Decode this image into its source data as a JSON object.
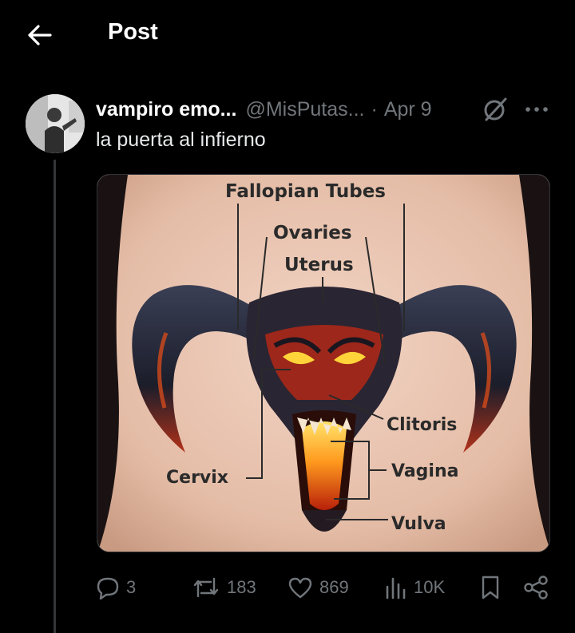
{
  "header": {
    "title": "Post",
    "back_icon": "arrow-left-icon"
  },
  "post": {
    "display_name": "vampiro emo...",
    "handle": "@MisPutas...",
    "separator": "·",
    "date": "Apr 9",
    "text": "la puerta al infierno",
    "icons": {
      "grok": "grok-icon",
      "more": "more-dots-icon"
    }
  },
  "media": {
    "labels": {
      "fallopian_tubes": "Fallopian Tubes",
      "ovaries": "Ovaries",
      "uterus": "Uterus",
      "clitoris": "Clitoris",
      "cervix": "Cervix",
      "vagina": "Vagina",
      "vulva": "Vulva"
    }
  },
  "actions": {
    "replies": "3",
    "reposts": "183",
    "likes": "869",
    "views": "10K",
    "icons": [
      "reply-icon",
      "repost-icon",
      "like-icon",
      "views-icon",
      "bookmark-icon",
      "share-icon"
    ]
  },
  "colors": {
    "background": "#000000",
    "text_primary": "#e7e9ea",
    "text_secondary": "#71767b",
    "divider": "#333639"
  }
}
